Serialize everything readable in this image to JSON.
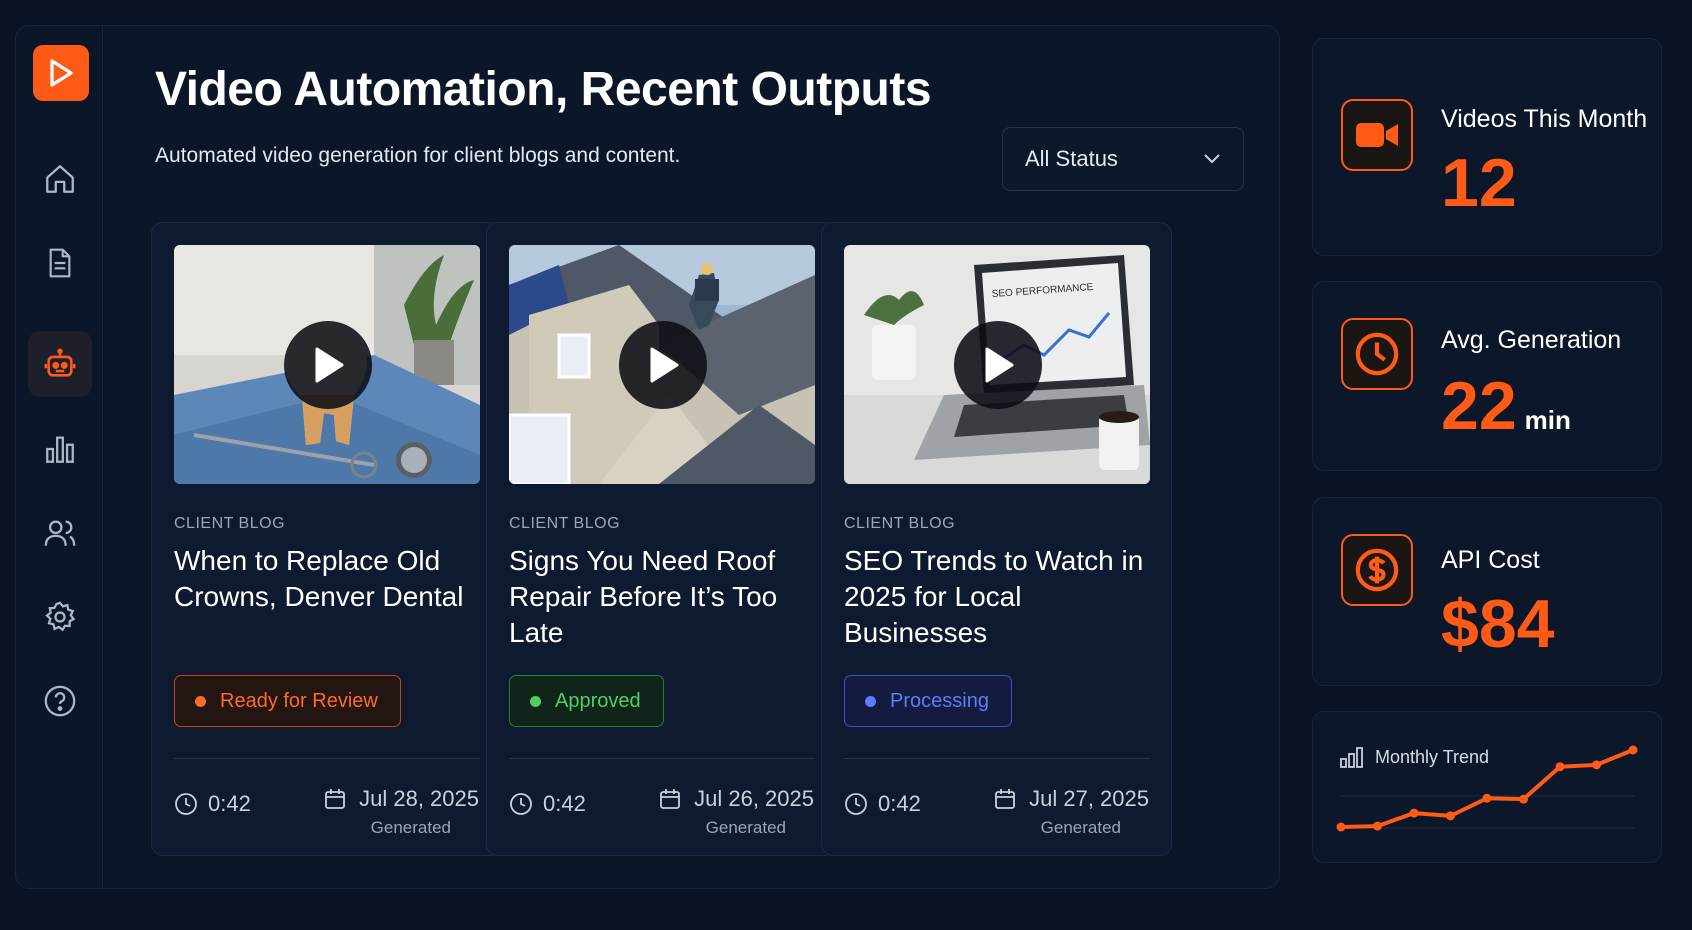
{
  "header": {
    "title": "Video Automation, Recent Outputs",
    "subtitle": "Automated video generation for client blogs and content."
  },
  "filter": {
    "selected": "All Status"
  },
  "sidebar": {
    "items": [
      {
        "icon": "home-icon",
        "active": false
      },
      {
        "icon": "document-icon",
        "active": false
      },
      {
        "icon": "robot-icon",
        "active": true
      },
      {
        "icon": "bar-chart-icon",
        "active": false
      },
      {
        "icon": "users-icon",
        "active": false
      },
      {
        "icon": "gear-icon",
        "active": false
      },
      {
        "icon": "help-icon",
        "active": false
      }
    ]
  },
  "cards": [
    {
      "category": "CLIENT BLOG",
      "title": "When to Replace Old Crowns, Denver Dental",
      "status": "Ready for Review",
      "duration": "0:42",
      "date": "Jul 28, 2025",
      "date_label": "Generated"
    },
    {
      "category": "CLIENT BLOG",
      "title": "Signs You Need Roof Repair Before It’s Too Late",
      "status": "Approved",
      "duration": "0:42",
      "date": "Jul 26, 2025",
      "date_label": "Generated"
    },
    {
      "category": "CLIENT BLOG",
      "title": "SEO Trends to Watch in 2025 for Local Businesses",
      "status": "Processing",
      "duration": "0:42",
      "date": "Jul 27, 2025",
      "date_label": "Generated",
      "thumb_text": "SEO PERFORMANCE"
    }
  ],
  "stats": {
    "videos": {
      "label": "Videos This Month",
      "value": "12"
    },
    "generation": {
      "label": "Avg. Generation",
      "value": "22",
      "unit": "min"
    },
    "cost": {
      "label": "API Cost",
      "value": "$84"
    }
  },
  "trend": {
    "label": "Monthly Trend",
    "values": [
      1,
      1.1,
      2.5,
      2.2,
      4.1,
      4.0,
      7.5,
      7.7,
      9.3
    ]
  },
  "colors": {
    "accent": "#ff5a16",
    "review": "#ff6a26",
    "approved": "#4fd160",
    "processing": "#5d7cff"
  }
}
